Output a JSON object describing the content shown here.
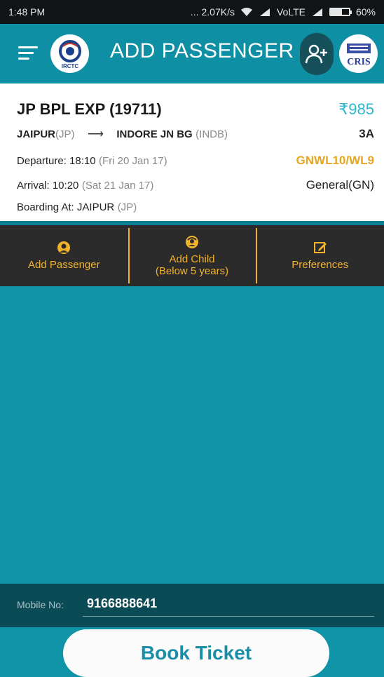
{
  "status_bar": {
    "time": "1:48 PM",
    "speed": "... 2.07K/s",
    "network": "VoLTE",
    "battery": "60%"
  },
  "header": {
    "title": "ADD PASSENGER",
    "logo_left_text": "IRCTC",
    "logo_right_text": "CRIS",
    "accent": "#0e8fa4"
  },
  "train": {
    "name": "JP BPL EXP (19711)",
    "fare": "₹985",
    "from_station": "JAIPUR",
    "from_code": "(JP)",
    "to_station": "INDORE JN BG",
    "to_code": "(INDB)",
    "class": "3A",
    "departure_label": "Departure: 18:10",
    "departure_date": "(Fri 20 Jan 17)",
    "availability": "GNWL10/WL9",
    "arrival_label": "Arrival: 10:20",
    "arrival_date": "(Sat 21 Jan 17)",
    "quota": "General(GN)",
    "boarding_label": "Boarding At: JAIPUR",
    "boarding_code": "(JP)"
  },
  "tabs": [
    {
      "label": "Add Passenger",
      "icon": "person-icon"
    },
    {
      "label": "Add Child",
      "sublabel": "(Below 5 years)",
      "icon": "child-icon"
    },
    {
      "label": "Preferences",
      "icon": "edit-icon"
    }
  ],
  "mobile": {
    "label": "Mobile No:",
    "value": "9166888641"
  },
  "book_button": {
    "label": "Book Ticket"
  },
  "colors": {
    "background": "#0f93a7",
    "tab_bar": "#2b2b2b",
    "tab_text": "#f2b22a",
    "fare": "#2db7cf",
    "waitlist": "#e6a620"
  }
}
